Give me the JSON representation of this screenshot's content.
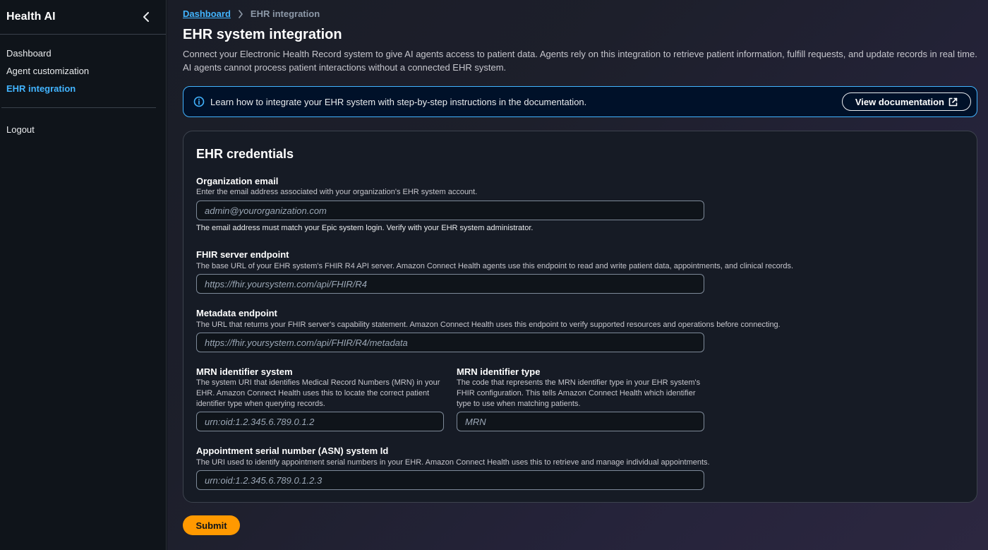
{
  "sidebar": {
    "app_title": "Health AI",
    "collapse_icon": "chevron-left-icon",
    "items": [
      {
        "label": "Dashboard",
        "active": false
      },
      {
        "label": "Agent customization",
        "active": false
      },
      {
        "label": "EHR integration",
        "active": true
      }
    ],
    "logout_label": "Logout"
  },
  "breadcrumb": {
    "root": "Dashboard",
    "separator_icon": "chevron-right-icon",
    "current": "EHR integration"
  },
  "page": {
    "title": "EHR system integration",
    "description": "Connect your Electronic Health Record system to give AI agents access to patient data. Agents rely on this integration to retrieve patient information, fulfill requests, and update records in real time. AI agents cannot process patient interactions without a connected EHR system."
  },
  "info_banner": {
    "icon": "info-icon",
    "text": "Learn how to integrate your EHR system with step-by-step instructions in the documentation.",
    "button_label": "View documentation",
    "button_icon": "external-link-icon"
  },
  "credentials": {
    "title": "EHR credentials",
    "org_email": {
      "label": "Organization email",
      "description": "Enter the email address associated with your organization's EHR system account.",
      "placeholder": "admin@yourorganization.com",
      "constraint": "The email address must match your Epic system login. Verify with your EHR system administrator."
    },
    "fhir_endpoint": {
      "label": "FHIR server endpoint",
      "description": "The base URL of your EHR system's FHIR R4 API server. Amazon Connect Health agents use this endpoint to read and write patient data, appointments, and clinical records.",
      "placeholder": "https://fhir.yoursystem.com/api/FHIR/R4"
    },
    "metadata_endpoint": {
      "label": "Metadata endpoint",
      "description": "The URL that returns your FHIR server's capability statement. Amazon Connect Health uses this endpoint to verify supported resources and operations before connecting.",
      "placeholder": "https://fhir.yoursystem.com/api/FHIR/R4/metadata"
    },
    "mrn_system": {
      "label": "MRN identifier system",
      "description": "The system URI that identifies Medical Record Numbers (MRN) in your EHR. Amazon Connect Health uses this to locate the correct patient identifier type when querying records.",
      "placeholder": "urn:oid:1.2.345.6.789.0.1.2"
    },
    "mrn_type": {
      "label": "MRN identifier type",
      "description": "The code that represents the MRN identifier type in your EHR system's FHIR configuration. This tells Amazon Connect Health which identifier type to use when matching patients.",
      "placeholder": "MRN"
    },
    "asn_system": {
      "label": "Appointment serial number (ASN) system Id",
      "description": "The URI used to identify appointment serial numbers in your EHR. Amazon Connect Health uses this to retrieve and manage individual appointments.",
      "placeholder": "urn:oid:1.2.345.6.789.0.1.2.3"
    }
  },
  "submit_label": "Submit",
  "colors": {
    "accent": "#42b4ff",
    "primary_button": "#ff9900",
    "banner_bg": "#001129"
  }
}
